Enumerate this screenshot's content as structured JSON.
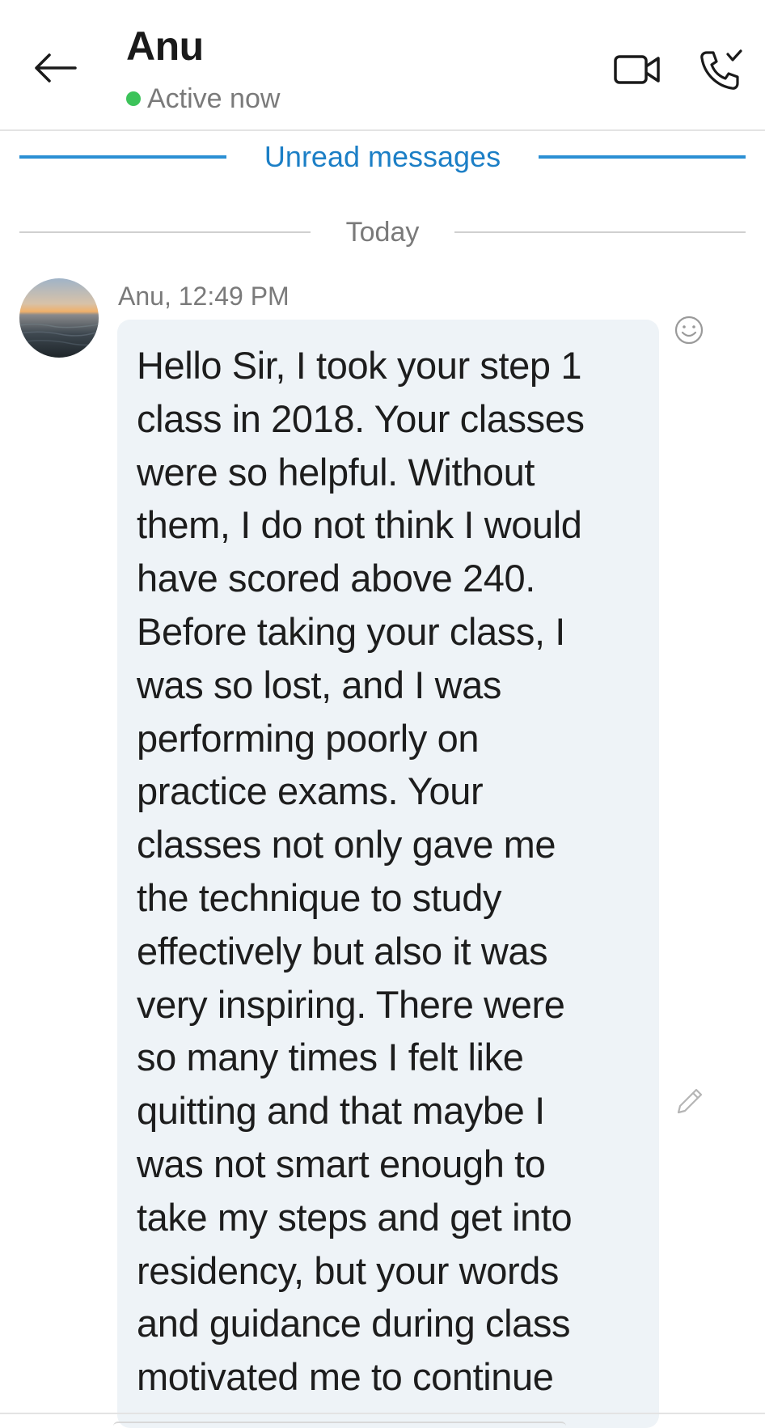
{
  "header": {
    "contact_name": "Anu",
    "status": "Active now",
    "status_color": "#3cc35a",
    "icons": {
      "back": "arrow-left-icon",
      "video": "video-call-icon",
      "call": "phone-call-icon"
    }
  },
  "dividers": {
    "unread": "Unread messages",
    "date": "Today"
  },
  "message": {
    "sender_time": "Anu, 12:49 PM",
    "text": "Hello Sir, I took your step 1\nclass in 2018. Your classes\nwere so helpful. Without\nthem, I do not think I would\nhave scored above 240.\nBefore taking your class, I\nwas so lost, and I was\nperforming poorly on\npractice exams. Your\nclasses not only gave me\nthe technique to study\neffectively but also it was\nvery inspiring. There were\nso many times I felt like\nquitting and that maybe I\nwas not smart enough to\ntake my steps and get into\nresidency, but your words\nand guidance during class\nmotivated me to continue",
    "actions": {
      "react": "smiley-icon",
      "edit": "pencil-icon"
    }
  },
  "colors": {
    "accent": "#1c7fc6",
    "bubble": "#eef3f7"
  }
}
